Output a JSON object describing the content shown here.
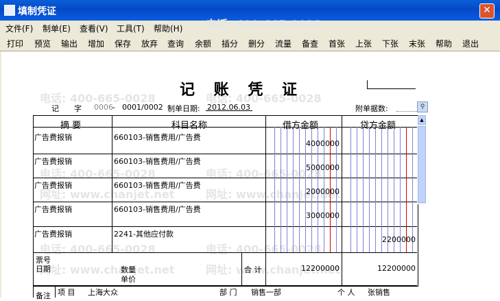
{
  "window": {
    "title": "填制凭证",
    "close": "✕"
  },
  "menu": [
    "文件(F)",
    "制单(E)",
    "查看(V)",
    "工具(T)",
    "帮助(H)"
  ],
  "toolbar": [
    "打印",
    "预览",
    "输出",
    "增加",
    "保存",
    "放弃",
    "查询",
    "余额",
    "插分",
    "删分",
    "流量",
    "备查",
    "首张",
    "上张",
    "下张",
    "末张",
    "帮助",
    "退出"
  ],
  "voucher": {
    "heading": "记 账 凭 证",
    "type_char": "记",
    "zi": "字",
    "number": "0006",
    "dash": "-",
    "sub_number": "0001/0002",
    "date_label": "制单日期:",
    "date": "2012.06.03",
    "attach_label": "附单据数:",
    "col_summary": "摘  要",
    "col_account": "科目名称",
    "col_debit": "借方金额",
    "col_credit": "贷方金额",
    "rows": [
      {
        "summary": "广告费报销",
        "account": "660103-销售费用/广告费",
        "debit": "4000000",
        "credit": ""
      },
      {
        "summary": "广告费报销",
        "account": "660103-销售费用/广告费",
        "debit": "5000000",
        "credit": ""
      },
      {
        "summary": "广告费报销",
        "account": "660103-销售费用/广告费",
        "debit": "2000000",
        "credit": ""
      },
      {
        "summary": "广告费报销",
        "account": "660103-销售费用/广告费",
        "debit": "3000000",
        "credit": ""
      },
      {
        "summary": "广告费报销",
        "account": "2241-其他应付款",
        "debit": "",
        "credit": "2200000"
      }
    ],
    "bill_no_label": "票号",
    "date2_label": "日期",
    "qty_label": "数量",
    "price_label": "单价",
    "total_label": "合 计",
    "total_debit": "12200000",
    "total_credit": "12200000",
    "notes_label": "备注",
    "project_label": "项  目",
    "project_value": "上海大众",
    "dept_label": "部  门",
    "dept_value": "销售一部",
    "person_label": "个  人",
    "person_value": "张销售"
  },
  "watermarks": {
    "phone": "电话: 400-665-0028",
    "site": "网址: www.chanjet.net"
  }
}
